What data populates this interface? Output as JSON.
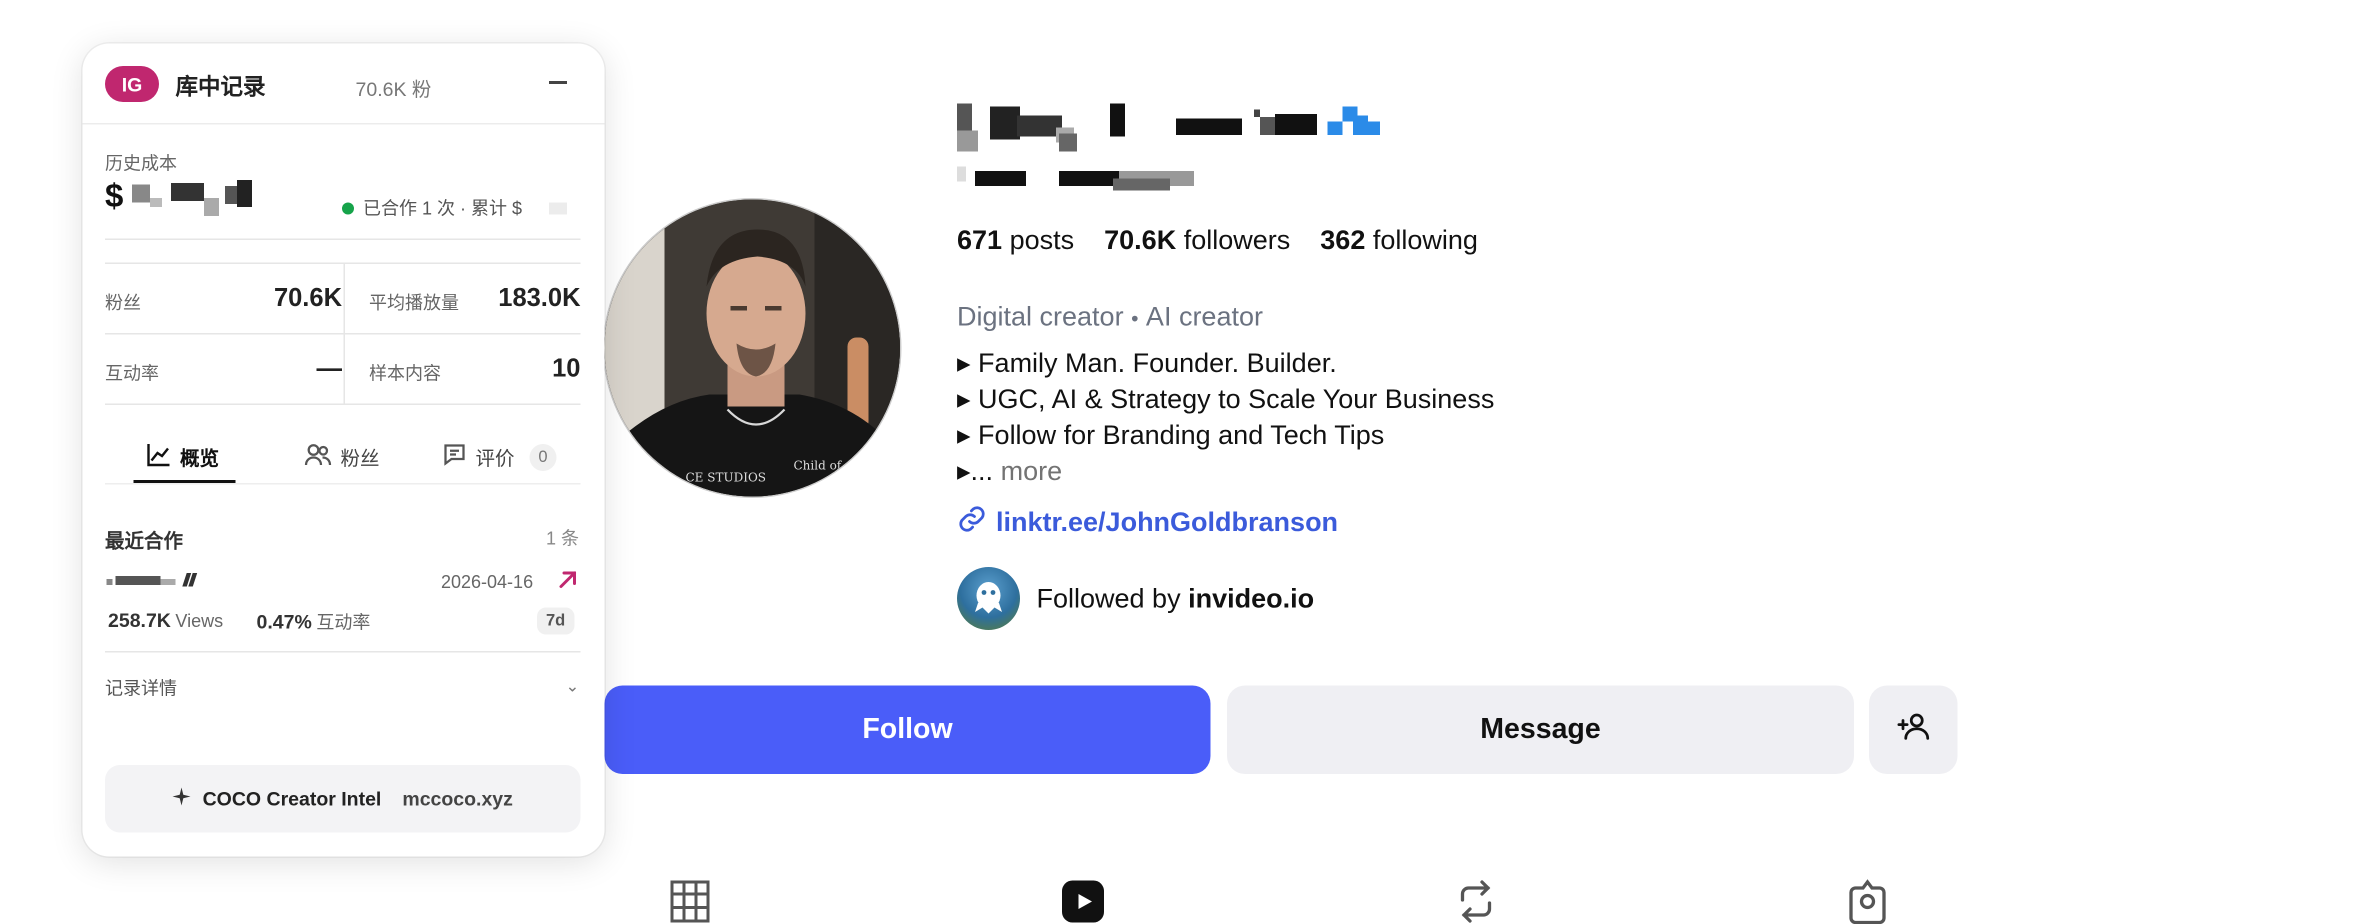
{
  "profile": {
    "stats": {
      "posts_count": "671",
      "posts_label": "posts",
      "followers_count": "70.6K",
      "followers_label": "followers",
      "following_count": "362",
      "following_label": "following"
    },
    "category_1": "Digital creator",
    "category_sep": "•",
    "category_2": "AI creator",
    "bio_lines": [
      "▸ Family Man. Founder. Builder.",
      "▸ UGC, AI & Strategy to Scale Your Business",
      "▸ Follow for Branding and Tech Tips"
    ],
    "bio_ellipsis": "▸...",
    "bio_more": "more",
    "link_text": "linktr.ee/JohnGoldbranson",
    "followed_by_prefix": "Followed by",
    "followed_by_name": "invideo.io",
    "follow_button": "Follow",
    "message_button": "Message",
    "add_user_icon": "person-add-icon",
    "tabs_icons": [
      "grid-icon",
      "reels-icon",
      "repost-icon",
      "tagged-icon"
    ],
    "colors": {
      "follow": "#4a5df9",
      "link": "#3b5bdb",
      "secondary_button": "#efeff3"
    }
  },
  "panel": {
    "platform_badge": "IG",
    "title": "库中记录",
    "fans_summary": "70.6K 粉",
    "minimize_icon": "minus-icon",
    "history_cost_label": "历史成本",
    "history_cost_prefix": "$",
    "coop_text": "已合作 1 次 · 累计 $",
    "metrics": {
      "fans_label": "粉丝",
      "fans_value": "70.6K",
      "avg_play_label": "平均播放量",
      "avg_play_value": "183.0K",
      "engagement_label": "互动率",
      "engagement_value": "—",
      "sample_label": "样本内容",
      "sample_value": "10"
    },
    "tabs": {
      "overview": "概览",
      "fans": "粉丝",
      "reviews": "评价",
      "reviews_count": "0"
    },
    "recent": {
      "title": "最近合作",
      "count": "1 条",
      "date": "2026-04-16",
      "views": "258.7K",
      "views_label": "Views",
      "engagement": "0.47%",
      "engagement_label": "互动率",
      "age": "7d"
    },
    "details_label": "记录详情",
    "details_chevron": "⌄",
    "footer_brand": "COCO Creator Intel",
    "footer_domain": "mccoco.xyz",
    "colors": {
      "badge": "#c0276f",
      "status": "#16a34a",
      "trend": "#c0276f"
    }
  }
}
